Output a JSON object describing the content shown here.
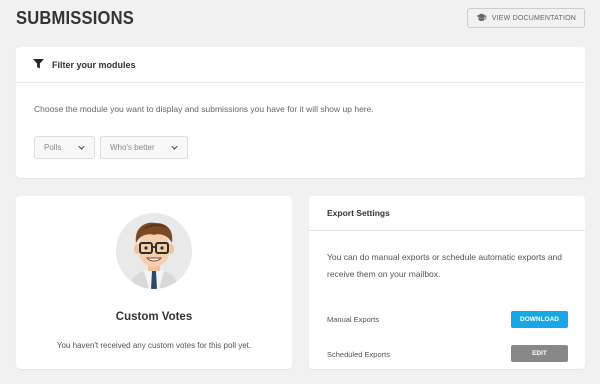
{
  "header": {
    "title": "SUBMISSIONS",
    "doc_button": {
      "label": "VIEW DOCUMENTATION",
      "icon": "graduation-cap-icon"
    }
  },
  "filter": {
    "title": "Filter your modules",
    "icon": "filter-icon",
    "description": "Choose the module you want to display and submissions you have for it will show up here.",
    "module_type": {
      "value": "Polls",
      "icon": "chevron-down-icon"
    },
    "module": {
      "value": "Who's better",
      "icon": "chevron-down-icon"
    }
  },
  "votes": {
    "title": "Custom Votes",
    "message": "You haven't received any custom votes for this poll yet."
  },
  "export": {
    "title": "Export Settings",
    "description": "You can do manual exports or schedule automatic exports and receive them on your mailbox.",
    "manual": {
      "label": "Manual Exports",
      "button": "DOWNLOAD"
    },
    "scheduled": {
      "label": "Scheduled Exports",
      "button": "EDIT"
    }
  },
  "colors": {
    "background": "#f1f1f1",
    "primary_button": "#17a8e3",
    "secondary_button": "#888888",
    "card": "#ffffff"
  }
}
